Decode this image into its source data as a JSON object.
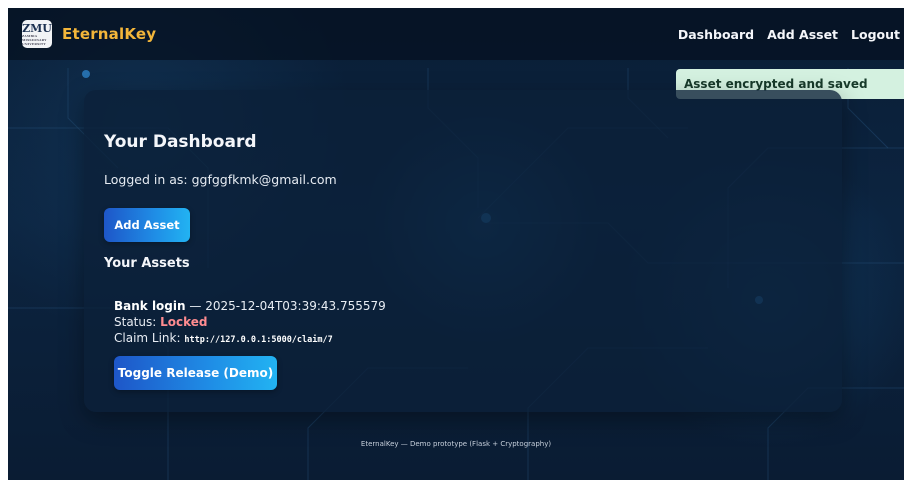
{
  "navbar": {
    "logo_text": "ZMU",
    "logo_subtext": "ZAMBIA MISSIONARY UNIVERSITY",
    "brand": "EternalKey",
    "links": [
      {
        "label": "Dashboard"
      },
      {
        "label": "Add Asset"
      },
      {
        "label": "Logout"
      }
    ]
  },
  "flash": {
    "message": "Asset encrypted and saved"
  },
  "dashboard": {
    "title": "Your Dashboard",
    "logged_in_text": "Logged in as: ggfggfkmk@gmail.com",
    "add_asset_label": "Add Asset",
    "assets_heading": "Your Assets",
    "assets": [
      {
        "name": "Bank login",
        "separator": " — ",
        "timestamp": "2025-12-04T03:39:43.755579",
        "status_label": "Status: ",
        "status_value": "Locked",
        "claim_label": "Claim Link: ",
        "claim_url": "http://127.0.0.1:5000/claim/7",
        "toggle_label": "Toggle Release (Demo)"
      }
    ]
  },
  "footer": {
    "text": "EternalKey — Demo prototype (Flask + Cryptography)"
  },
  "colors": {
    "background": "#0b2240",
    "brand": "#f3b63a",
    "button_start": "#1e56c8",
    "button_end": "#22b3f2",
    "flash_bg": "#d4f1e0",
    "status_locked": "#ff8c90"
  }
}
